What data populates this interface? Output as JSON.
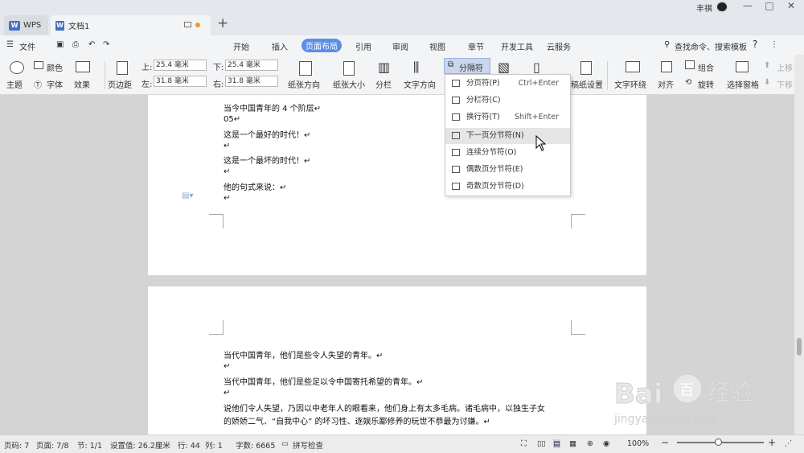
{
  "titlebar": {
    "wps_tab": "WPS",
    "doc_tab": "文档1",
    "user": "丰祺",
    "win_min": "—",
    "win_max": "□",
    "win_close": "✕"
  },
  "menu": {
    "file": "文件",
    "items": [
      "开始",
      "插入",
      "页面布局",
      "引用",
      "审阅",
      "视图",
      "章节",
      "开发工具",
      "云服务"
    ],
    "search": "查找命令、搜索模板",
    "help": "?"
  },
  "ribbon": {
    "theme": "主题",
    "color": "颜色",
    "font": "字体",
    "effect": "效果",
    "margin": "页边距",
    "top_label": "上:",
    "top_val": "25.4 毫米",
    "bottom_label": "下:",
    "bottom_val": "25.4 毫米",
    "left_label": "左:",
    "left_val": "31.8 毫米",
    "right_label": "右:",
    "right_val": "31.8 毫米",
    "orientation": "纸张方向",
    "size": "纸张大小",
    "columns": "分栏",
    "text_dir": "文字方向",
    "breaks": "分隔符",
    "manuscript": "稿纸设置",
    "wrap": "文字环绕",
    "align": "对齐",
    "group": "组合",
    "rotate": "旋转",
    "select_pane": "选择窗格",
    "up": "上移",
    "down": "下移"
  },
  "dropdown": [
    {
      "label": "分页符(P)",
      "shortcut": "Ctrl+Enter"
    },
    {
      "label": "分栏符(C)",
      "shortcut": ""
    },
    {
      "label": "换行符(T)",
      "shortcut": "Shift+Enter"
    },
    {
      "label": "下一页分节符(N)",
      "shortcut": ""
    },
    {
      "label": "连续分节符(O)",
      "shortcut": ""
    },
    {
      "label": "偶数页分节符(E)",
      "shortcut": ""
    },
    {
      "label": "奇数页分节符(D)",
      "shortcut": ""
    }
  ],
  "page1": [
    "当今中国青年的 4 个阶层↵",
    "05↵",
    "这是一个最好的时代！↵",
    "↵",
    "这是一个最坏的时代！↵",
    "↵",
    "他的句式来说：↵",
    "↵"
  ],
  "page2": [
    "当代中国青年，他们是些令人失望的青年。↵",
    "↵",
    "当代中国青年，他们是些足以令中国寄托希望的青年。↵",
    "↵",
    "说他们令人失望，乃因以中老年人的眼看来，他们身上有太多毛病。诸毛病中，以独生子女",
    "的娇娇二气、“自我中心” 的坏习性、逐娱乐鄙修养的玩世不恭最为讨嫌。↵"
  ],
  "status": {
    "page_no": "页码: 7",
    "page": "页面: 7/8",
    "section": "节: 1/1",
    "setting": "设置值: 26.2厘米",
    "row": "行: 44",
    "col": "列: 1",
    "words": "字数: 6665",
    "spell": "拼写检查",
    "zoom": "100%"
  },
  "watermark": {
    "brand": "Bai",
    "brand2": "百",
    "brand3": "经验",
    "url": "jingyan.baidu.com"
  }
}
